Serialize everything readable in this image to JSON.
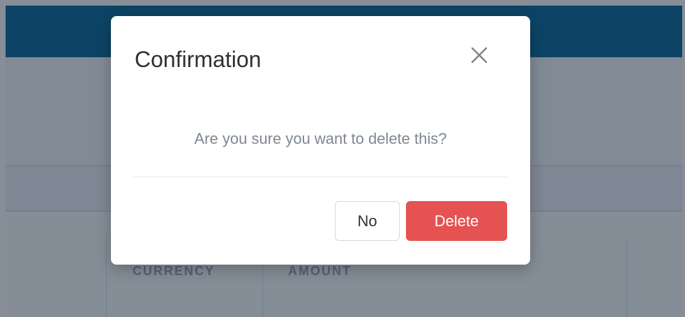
{
  "background": {
    "table": {
      "columns": [
        "CURRENCY",
        "AMOUNT"
      ]
    }
  },
  "modal": {
    "title": "Confirmation",
    "close_icon": "close-icon",
    "message": "Are you sure you want to delete this?",
    "buttons": {
      "no_label": "No",
      "delete_label": "Delete"
    }
  },
  "colors": {
    "header": "#0b6a98",
    "danger": "#e45252",
    "overlay": "rgba(16,30,50,0.5)"
  }
}
